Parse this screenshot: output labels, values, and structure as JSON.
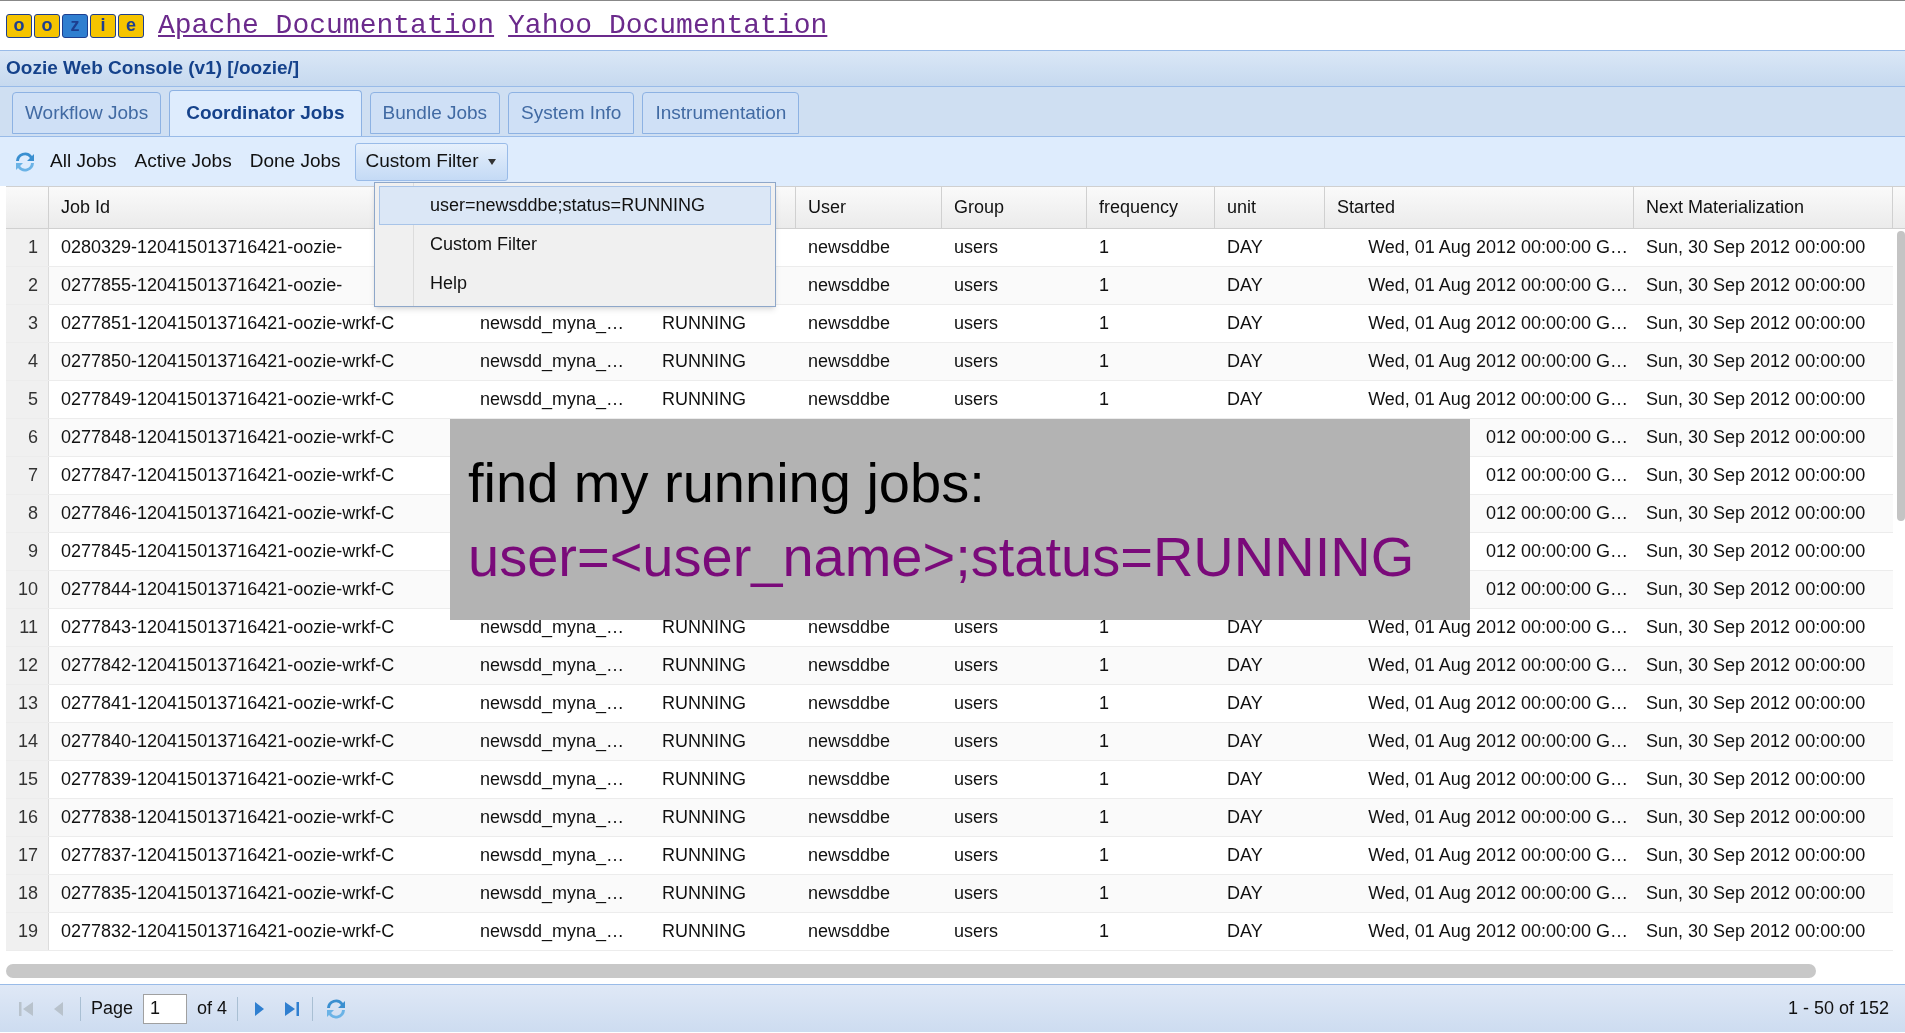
{
  "header": {
    "logo_letters": [
      "o",
      "o",
      "z",
      "i",
      "e"
    ],
    "links": [
      "Apache Documentation",
      "Yahoo Documentation"
    ]
  },
  "console_title": "Oozie Web Console (v1) [/oozie/]",
  "tabs": [
    {
      "label": "Workflow Jobs",
      "selected": false
    },
    {
      "label": "Coordinator Jobs",
      "selected": true
    },
    {
      "label": "Bundle Jobs",
      "selected": false
    },
    {
      "label": "System Info",
      "selected": false
    },
    {
      "label": "Instrumentation",
      "selected": false
    }
  ],
  "toolbar": {
    "filters": [
      "All Jobs",
      "Active Jobs",
      "Done Jobs"
    ],
    "custom_filter": {
      "label": "Custom Filter",
      "expanded": true
    }
  },
  "dropdown": [
    {
      "label": "user=newsddbe;status=RUNNING",
      "selected": true
    },
    {
      "label": "Custom Filter",
      "selected": false
    },
    {
      "label": "Help",
      "selected": false
    }
  ],
  "table": {
    "columns": {
      "job_id": "Job Id",
      "user": "User",
      "group": "Group",
      "frequency": "frequency",
      "unit": "unit",
      "started": "Started",
      "next_materialization": "Next Materialization"
    },
    "rows": [
      {
        "number": "1",
        "job_id": "0280329-120415013716421-oozie-",
        "user": "newsddbe",
        "group": "users",
        "frequency": "1",
        "unit": "DAY",
        "started": "Wed, 01 Aug 2012 00:00:00 G…",
        "next_materialization": "Sun, 30 Sep 2012 00:00:00"
      },
      {
        "number": "2",
        "job_id": "0277855-120415013716421-oozie-",
        "user": "newsddbe",
        "group": "users",
        "frequency": "1",
        "unit": "DAY",
        "started": "Wed, 01 Aug 2012 00:00:00 G…",
        "next_materialization": "Sun, 30 Sep 2012 00:00:00"
      },
      {
        "number": "3",
        "job_id": "0277851-120415013716421-oozie-wrkf-C",
        "column_3": "newsdd_myna_…",
        "column_4": "RUNNING",
        "user": "newsddbe",
        "group": "users",
        "frequency": "1",
        "unit": "DAY",
        "started": "Wed, 01 Aug 2012 00:00:00 G…",
        "next_materialization": "Sun, 30 Sep 2012 00:00:00"
      },
      {
        "number": "4",
        "job_id": "0277850-120415013716421-oozie-wrkf-C",
        "column_3": "newsdd_myna_…",
        "column_4": "RUNNING",
        "user": "newsddbe",
        "group": "users",
        "frequency": "1",
        "unit": "DAY",
        "started": "Wed, 01 Aug 2012 00:00:00 G…",
        "next_materialization": "Sun, 30 Sep 2012 00:00:00"
      },
      {
        "number": "5",
        "job_id": "0277849-120415013716421-oozie-wrkf-C",
        "column_3": "newsdd_myna_…",
        "column_4": "RUNNING",
        "user": "newsddbe",
        "group": "users",
        "frequency": "1",
        "unit": "DAY",
        "started": "Wed, 01 Aug 2012 00:00:00 G…",
        "next_materialization": "Sun, 30 Sep 2012 00:00:00"
      },
      {
        "number": "6",
        "job_id": "0277848-120415013716421-oozie-wrkf-C",
        "started": "012 00:00:00 G…",
        "next_materialization": "Sun, 30 Sep 2012 00:00:00"
      },
      {
        "number": "7",
        "job_id": "0277847-120415013716421-oozie-wrkf-C",
        "started": "012 00:00:00 G…",
        "next_materialization": "Sun, 30 Sep 2012 00:00:00"
      },
      {
        "number": "8",
        "job_id": "0277846-120415013716421-oozie-wrkf-C",
        "started": "012 00:00:00 G…",
        "next_materialization": "Sun, 30 Sep 2012 00:00:00"
      },
      {
        "number": "9",
        "job_id": "0277845-120415013716421-oozie-wrkf-C",
        "started": "012 00:00:00 G…",
        "next_materialization": "Sun, 30 Sep 2012 00:00:00"
      },
      {
        "number": "10",
        "job_id": "0277844-120415013716421-oozie-wrkf-C",
        "started": "012 00:00:00 G…",
        "next_materialization": "Sun, 30 Sep 2012 00:00:00"
      },
      {
        "number": "11",
        "job_id": "0277843-120415013716421-oozie-wrkf-C",
        "column_3": "newsdd_myna_…",
        "column_4": "RUNNING",
        "user": "newsddbe",
        "group": "users",
        "frequency": "1",
        "unit": "DAY",
        "started": "Wed, 01 Aug 2012 00:00:00 G…",
        "next_materialization": "Sun, 30 Sep 2012 00:00:00"
      },
      {
        "number": "12",
        "job_id": "0277842-120415013716421-oozie-wrkf-C",
        "column_3": "newsdd_myna_…",
        "column_4": "RUNNING",
        "user": "newsddbe",
        "group": "users",
        "frequency": "1",
        "unit": "DAY",
        "started": "Wed, 01 Aug 2012 00:00:00 G…",
        "next_materialization": "Sun, 30 Sep 2012 00:00:00"
      },
      {
        "number": "13",
        "job_id": "0277841-120415013716421-oozie-wrkf-C",
        "column_3": "newsdd_myna_…",
        "column_4": "RUNNING",
        "user": "newsddbe",
        "group": "users",
        "frequency": "1",
        "unit": "DAY",
        "started": "Wed, 01 Aug 2012 00:00:00 G…",
        "next_materialization": "Sun, 30 Sep 2012 00:00:00"
      },
      {
        "number": "14",
        "job_id": "0277840-120415013716421-oozie-wrkf-C",
        "column_3": "newsdd_myna_…",
        "column_4": "RUNNING",
        "user": "newsddbe",
        "group": "users",
        "frequency": "1",
        "unit": "DAY",
        "started": "Wed, 01 Aug 2012 00:00:00 G…",
        "next_materialization": "Sun, 30 Sep 2012 00:00:00"
      },
      {
        "number": "15",
        "job_id": "0277839-120415013716421-oozie-wrkf-C",
        "column_3": "newsdd_myna_…",
        "column_4": "RUNNING",
        "user": "newsddbe",
        "group": "users",
        "frequency": "1",
        "unit": "DAY",
        "started": "Wed, 01 Aug 2012 00:00:00 G…",
        "next_materialization": "Sun, 30 Sep 2012 00:00:00"
      },
      {
        "number": "16",
        "job_id": "0277838-120415013716421-oozie-wrkf-C",
        "column_3": "newsdd_myna_…",
        "column_4": "RUNNING",
        "user": "newsddbe",
        "group": "users",
        "frequency": "1",
        "unit": "DAY",
        "started": "Wed, 01 Aug 2012 00:00:00 G…",
        "next_materialization": "Sun, 30 Sep 2012 00:00:00"
      },
      {
        "number": "17",
        "job_id": "0277837-120415013716421-oozie-wrkf-C",
        "column_3": "newsdd_myna_…",
        "column_4": "RUNNING",
        "user": "newsddbe",
        "group": "users",
        "frequency": "1",
        "unit": "DAY",
        "started": "Wed, 01 Aug 2012 00:00:00 G…",
        "next_materialization": "Sun, 30 Sep 2012 00:00:00"
      },
      {
        "number": "18",
        "job_id": "0277835-120415013716421-oozie-wrkf-C",
        "column_3": "newsdd_myna_…",
        "column_4": "RUNNING",
        "user": "newsddbe",
        "group": "users",
        "frequency": "1",
        "unit": "DAY",
        "started": "Wed, 01 Aug 2012 00:00:00 G…",
        "next_materialization": "Sun, 30 Sep 2012 00:00:00"
      },
      {
        "number": "19",
        "job_id": "0277832-120415013716421-oozie-wrkf-C",
        "column_3": "newsdd_myna_…",
        "column_4": "RUNNING",
        "user": "newsddbe",
        "group": "users",
        "frequency": "1",
        "unit": "DAY",
        "started": "Wed, 01 Aug 2012 00:00:00 G…",
        "next_materialization": "Sun, 30 Sep 2012 00:00:00"
      }
    ]
  },
  "pager": {
    "buttons": [
      {
        "kind": "first",
        "disabled": true
      },
      {
        "kind": "previous",
        "disabled": true
      }
    ],
    "page_label": "Page",
    "page_value": "1",
    "of_label": "of 4",
    "next_buttons": [
      {
        "kind": "next",
        "disabled": false
      },
      {
        "kind": "last",
        "disabled": false
      }
    ],
    "summary": "1 - 50 of 152"
  },
  "annotation": {
    "heading": "find my running jobs:",
    "example": "user=<user_name>;status=RUNNING"
  }
}
